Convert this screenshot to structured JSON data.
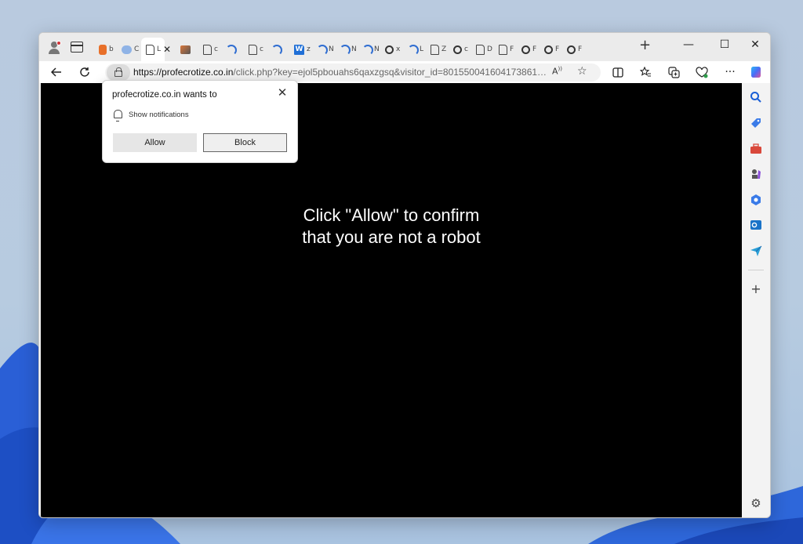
{
  "browser": {
    "tabs": [
      {
        "favicon": "orange-icon",
        "label": "b"
      },
      {
        "favicon": "cloud-icon",
        "label": "C"
      },
      {
        "favicon": "page-icon",
        "label": "L"
      },
      {
        "favicon": "picture-icon",
        "label": ""
      },
      {
        "favicon": "page-icon",
        "label": "c"
      },
      {
        "favicon": "loading-icon",
        "label": ""
      },
      {
        "favicon": "page-icon",
        "label": "c"
      },
      {
        "favicon": "loading-icon",
        "label": ""
      },
      {
        "favicon": "w-icon",
        "label": "z"
      },
      {
        "favicon": "loading-icon",
        "label": "N"
      },
      {
        "favicon": "loading-icon",
        "label": "N"
      },
      {
        "favicon": "loading-icon",
        "label": "N"
      },
      {
        "favicon": "gear-icon",
        "label": "x"
      },
      {
        "favicon": "loading-icon",
        "label": "L"
      },
      {
        "favicon": "page-icon",
        "label": "Z"
      },
      {
        "favicon": "gear-icon",
        "label": "c"
      },
      {
        "favicon": "page-icon",
        "label": "D"
      },
      {
        "favicon": "page-icon",
        "label": "F"
      },
      {
        "favicon": "gear-icon",
        "label": "F"
      },
      {
        "favicon": "gear-icon",
        "label": "F"
      },
      {
        "favicon": "gear-icon",
        "label": "F"
      }
    ],
    "active_tab_close": "✕",
    "new_tab": "+",
    "window_controls": {
      "minimize": "—",
      "maximize": "☐",
      "close": "✕"
    },
    "address_bar": {
      "host": "https://profecrotize.co.in",
      "path": "/click.php?key=ejol5pbouahs6qaxzgsq&visitor_id=801550041604173861&cost..."
    }
  },
  "page": {
    "message_line1": "Click \"Allow\" to confirm",
    "message_line2": "that you are not a robot"
  },
  "permission_popup": {
    "title": "profecrotize.co.in wants to",
    "permission": "Show notifications",
    "allow_label": "Allow",
    "block_label": "Block",
    "close": "✕"
  },
  "sidebar": {
    "icons": [
      "search-icon",
      "tag-icon",
      "toolbox-icon",
      "chess-icon",
      "office-icon",
      "outlook-icon",
      "send-icon"
    ],
    "add": "+",
    "settings": "⚙"
  }
}
